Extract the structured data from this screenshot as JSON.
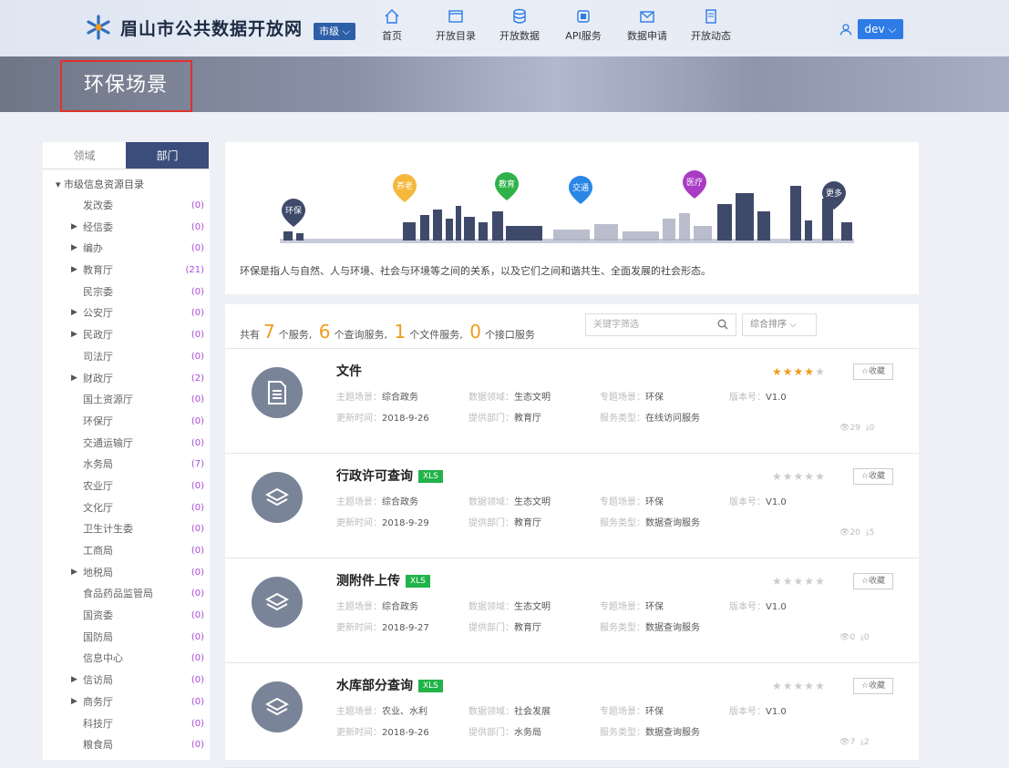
{
  "header": {
    "site_title": "眉山市公共数据开放网",
    "city_select": "市级",
    "nav": [
      {
        "label": "首页",
        "icon": "home-icon"
      },
      {
        "label": "开放目录",
        "icon": "folder-icon"
      },
      {
        "label": "开放数据",
        "icon": "database-icon"
      },
      {
        "label": "API服务",
        "icon": "api-icon"
      },
      {
        "label": "数据申请",
        "icon": "mail-icon"
      },
      {
        "label": "开放动态",
        "icon": "news-icon"
      }
    ],
    "user": "dev"
  },
  "banner": {
    "title": "环保场景"
  },
  "sidebar": {
    "tabs": [
      "领域",
      "部门"
    ],
    "root": "市级信息资源目录",
    "items": [
      {
        "label": "发改委",
        "count": "(0)",
        "expand": false
      },
      {
        "label": "经信委",
        "count": "(0)",
        "expand": true
      },
      {
        "label": "编办",
        "count": "(0)",
        "expand": true
      },
      {
        "label": "教育厅",
        "count": "(21)",
        "expand": true
      },
      {
        "label": "民宗委",
        "count": "(0)",
        "expand": false
      },
      {
        "label": "公安厅",
        "count": "(0)",
        "expand": true
      },
      {
        "label": "民政厅",
        "count": "(0)",
        "expand": true
      },
      {
        "label": "司法厅",
        "count": "(0)",
        "expand": false
      },
      {
        "label": "财政厅",
        "count": "(2)",
        "expand": true
      },
      {
        "label": "国土资源厅",
        "count": "(0)",
        "expand": false
      },
      {
        "label": "环保厅",
        "count": "(0)",
        "expand": false
      },
      {
        "label": "交通运输厅",
        "count": "(0)",
        "expand": false
      },
      {
        "label": "水务局",
        "count": "(7)",
        "expand": false
      },
      {
        "label": "农业厅",
        "count": "(0)",
        "expand": false
      },
      {
        "label": "文化厅",
        "count": "(0)",
        "expand": false
      },
      {
        "label": "卫生计生委",
        "count": "(0)",
        "expand": false
      },
      {
        "label": "工商局",
        "count": "(0)",
        "expand": false
      },
      {
        "label": "地税局",
        "count": "(0)",
        "expand": true
      },
      {
        "label": "食品药品监管局",
        "count": "(0)",
        "expand": false
      },
      {
        "label": "国资委",
        "count": "(0)",
        "expand": false
      },
      {
        "label": "国防局",
        "count": "(0)",
        "expand": false
      },
      {
        "label": "信息中心",
        "count": "(0)",
        "expand": false
      },
      {
        "label": "信访局",
        "count": "(0)",
        "expand": true
      },
      {
        "label": "商务厅",
        "count": "(0)",
        "expand": true
      },
      {
        "label": "科技厅",
        "count": "(0)",
        "expand": false
      },
      {
        "label": "粮食局",
        "count": "(0)",
        "expand": false
      }
    ]
  },
  "intro": {
    "pins": [
      {
        "label": "环保",
        "color": "#3f4a6b"
      },
      {
        "label": "养老",
        "color": "#f5b83d"
      },
      {
        "label": "教育",
        "color": "#2fb24a"
      },
      {
        "label": "交通",
        "color": "#2a86e6"
      },
      {
        "label": "医疗",
        "color": "#a93bc4"
      },
      {
        "label": "更多",
        "color": "#3f4a6b"
      }
    ],
    "description": "环保是指人与自然、人与环境、社会与环境等之间的关系，以及它们之间和谐共生、全面发展的社会形态。"
  },
  "results": {
    "summary": {
      "prefix": "共有",
      "total": "7",
      "total_unit": "个服务,",
      "query": "6",
      "query_unit": "个查询服务,",
      "file": "1",
      "file_unit": "个文件服务,",
      "api": "0",
      "api_unit": "个接口服务"
    },
    "search_placeholder": "关键字筛选",
    "sort": "综合排序",
    "fav_label": "收藏",
    "field_labels": {
      "scene": "主题场景：",
      "domain": "数据领域：",
      "topic": "专题场景：",
      "version": "版本号：",
      "updated": "更新时间：",
      "dept": "提供部门：",
      "type": "服务类型："
    },
    "items": [
      {
        "title": "文件",
        "xls": "",
        "rating": 4,
        "scene": "综合政务",
        "domain": "生态文明",
        "topic": "环保",
        "version": "V1.0",
        "updated": "2018-9-26",
        "dept": "教育厅",
        "type": "在线访问服务",
        "views": "29",
        "downloads": "0",
        "icon": "document-icon"
      },
      {
        "title": "行政许可查询",
        "xls": "XLS",
        "rating": 0,
        "scene": "综合政务",
        "domain": "生态文明",
        "topic": "环保",
        "version": "V1.0",
        "updated": "2018-9-29",
        "dept": "教育厅",
        "type": "数据查询服务",
        "views": "20",
        "downloads": "5",
        "icon": "layers-icon"
      },
      {
        "title": "测附件上传",
        "xls": "XLS",
        "rating": 0,
        "scene": "综合政务",
        "domain": "生态文明",
        "topic": "环保",
        "version": "V1.0",
        "updated": "2018-9-27",
        "dept": "教育厅",
        "type": "数据查询服务",
        "views": "0",
        "downloads": "0",
        "icon": "layers-icon"
      },
      {
        "title": "水库部分查询",
        "xls": "XLS",
        "rating": 0,
        "scene": "农业、水利",
        "domain": "社会发展",
        "topic": "环保",
        "version": "V1.0",
        "updated": "2018-9-26",
        "dept": "水务局",
        "type": "数据查询服务",
        "views": "7",
        "downloads": "2",
        "icon": "layers-icon"
      }
    ]
  }
}
